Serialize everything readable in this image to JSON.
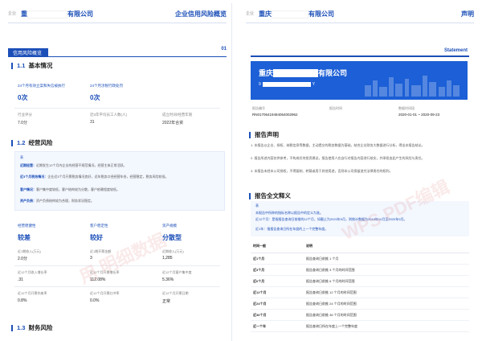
{
  "left_page": {
    "header": {
      "logo": "企业",
      "company_prefix": "重",
      "company_suffix": "有限公司",
      "report_title": "企业信用风险概览"
    },
    "section_tab": {
      "label": "信用风险概览",
      "num": "01"
    },
    "s11": {
      "num": "1.1",
      "title": "基本情况",
      "col1_label": "24个月有效立案和失信被执行",
      "col1_value": "0次",
      "col2_label": "24个月涉税行政处罚",
      "col2_value": "0次",
      "row2": [
        {
          "label": "行业评分",
          "value": "7.0分"
        },
        {
          "label": "近3年平均员工人数(人)",
          "value": "31"
        },
        {
          "label": "成立时间/经营年限",
          "value": "2022年合资"
        }
      ]
    },
    "s12": {
      "num": "1.2",
      "title": "经营风险",
      "box_head": "表",
      "box_lines": [
        {
          "k": "近期经营：",
          "t": "近期发生12个月内企业的经营不规范情况，经营主体正常活跃。"
        },
        {
          "k": "近3个月税务情况：",
          "t": "企业近3个月开票税务情况良好，近年税务口径经营年份，经营稳定，税务风险较低。"
        },
        {
          "k": "客户情况：",
          "t": "客户集中度较低，客户结构较为分散，客户依赖程度较低。"
        },
        {
          "k": "资产负债：",
          "t": "资产负债结构较为合理，财务状况稳定。"
        }
      ],
      "grades": [
        {
          "label": "经营稳健性",
          "value": "较差"
        },
        {
          "label": "客户稳定性",
          "value": "较好"
        },
        {
          "label": "资产规模",
          "value": "分散型"
        }
      ],
      "metrics": [
        {
          "label": "近1期收入(万元)",
          "value": "2.0分"
        },
        {
          "label": "近1期开票金额",
          "value": "3"
        },
        {
          "label": "近期收入(万元)",
          "value": "1,285"
        },
        {
          "label": "近12个月收入增长率",
          "value": ".31"
        },
        {
          "label": "近12个月开票增长率",
          "value": "112.08%"
        },
        {
          "label": "近12个月客户集中度",
          "value": "5.36%"
        },
        {
          "label": "近12个月开票作废率",
          "value": "0.8%"
        },
        {
          "label": "近12个月开票红冲率",
          "value": "0.0%"
        },
        {
          "label": "近12个月开票日期",
          "value": "正常"
        }
      ]
    },
    "s13": {
      "num": "1.3",
      "title": "财务风险"
    },
    "watermark": "用  明细数据"
  },
  "right_page": {
    "header": {
      "logo": "企业",
      "company_prefix": "重庆",
      "company_suffix": "有限公司",
      "report_title": "声明"
    },
    "top_label": "Statement",
    "banner": {
      "prefix": "重庆",
      "suffix": "有限公司",
      "sub_prefix": "9",
      "sub_suffix": "Y"
    },
    "meta": [
      {
        "label": "报告编号",
        "value": "RN01706419484064002962"
      },
      {
        "label": "报告时间",
        "value": ""
      },
      {
        "label": "数据时间段",
        "value": "2020-01-01 ~ 2020-09-23"
      }
    ],
    "statement": {
      "title": "报告声明",
      "paras": [
        "1. 本报告以企业、授权、纳税信息等数据，主动提交的税务数据为基础，结合企业财务大数据进行分析，得出本报告结论。",
        "2. 报告所述内容仅供参考，不构成任何投资建议，报告使用人应自行对报告内容进行核实，并承担由此产生的风险与责任。",
        "3. 本报告未经本公司授权，不得复制、转载或用于其他用途，否则本公司保留追究法律责任的权利。"
      ]
    },
    "definitions": {
      "title": "报告全文释义",
      "box_head": "表",
      "box_lines": [
        "本报告中所称的指标名称以报告中的定义为准。",
        "近12个月：是指报告查询日前推的12个月，如截止为2020年9月，则统计数据为2019年10月至2020年9月。",
        "近1年：指报告查询日所在年度的上一个完整年度。"
      ],
      "th_key": "时间一般",
      "th_desc": "说明",
      "rows": [
        {
          "k": "近1个月",
          "d": "报告查询日前推 1 个月"
        },
        {
          "k": "近3个月",
          "d": "报告查询日前推 3 个月的时间范围"
        },
        {
          "k": "近6个月",
          "d": "报告查询日前推 6 个月的时间范围"
        },
        {
          "k": "近12个月",
          "d": "报告查询日前推 12 个月的时间范围"
        },
        {
          "k": "近24个月",
          "d": "报告查询日前推 24 个月的时间范围"
        },
        {
          "k": "近36个月",
          "d": "报告查询日前推 36 个月的时间范围"
        },
        {
          "k": "近一个年",
          "d": "报告查询日所在年度上一个完整年度"
        }
      ]
    },
    "watermark": "WPS PDF编辑"
  }
}
